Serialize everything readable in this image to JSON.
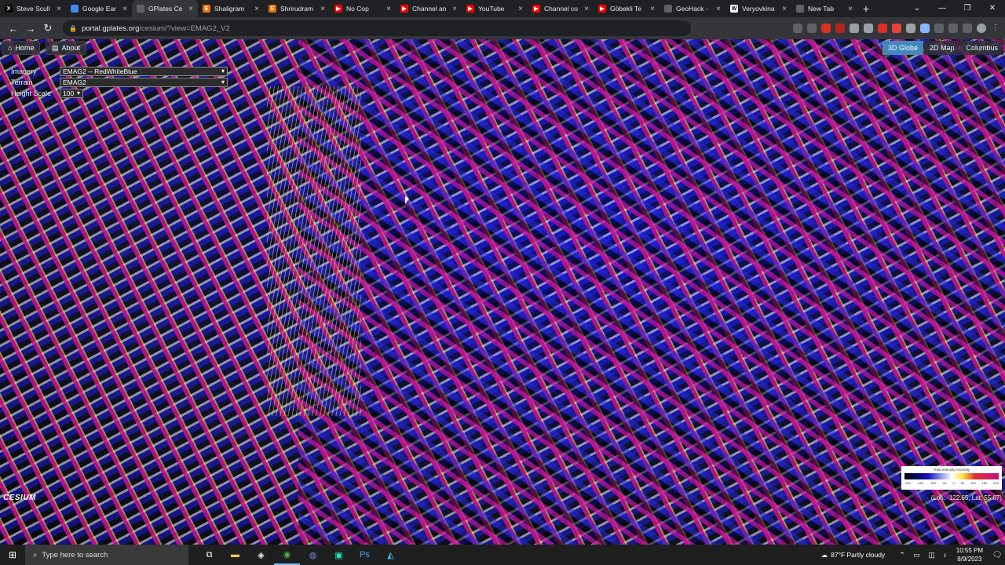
{
  "browser": {
    "tabs": [
      {
        "label": "Steve Scull",
        "icon": "x-icon",
        "color": "#000000",
        "glyph": "X"
      },
      {
        "label": "Google Ear",
        "icon": "google-earth-icon",
        "color": "#4285f4",
        "glyph": ""
      },
      {
        "label": "GPlates Ce",
        "icon": "gplates-icon",
        "color": "#5f6368",
        "glyph": "",
        "active": true
      },
      {
        "label": "Shaligram",
        "icon": "blogger-icon",
        "color": "#e8710a",
        "glyph": "E"
      },
      {
        "label": "Shrirudram",
        "icon": "blogger-icon",
        "color": "#e8710a",
        "glyph": "E"
      },
      {
        "label": "No Cop",
        "icon": "youtube-icon",
        "color": "#ff0000",
        "glyph": "▶"
      },
      {
        "label": "Channel an",
        "icon": "youtube-icon",
        "color": "#ff0000",
        "glyph": "▶"
      },
      {
        "label": "YouTube",
        "icon": "youtube-icon",
        "color": "#ff0000",
        "glyph": "▶"
      },
      {
        "label": "Channel co",
        "icon": "youtube-icon",
        "color": "#ff0000",
        "glyph": "▶"
      },
      {
        "label": "Göbekli Te",
        "icon": "youtube-icon",
        "color": "#ff0000",
        "glyph": "▶"
      },
      {
        "label": "GeoHack -",
        "icon": "globe-icon",
        "color": "#5f6368",
        "glyph": ""
      },
      {
        "label": "Veryovkina",
        "icon": "wikipedia-icon",
        "color": "#ffffff",
        "glyph": "W"
      },
      {
        "label": "New Tab",
        "icon": "chrome-icon",
        "color": "#5f6368",
        "glyph": ""
      }
    ],
    "url_host": "portal.gplates.org",
    "url_path": "/cesium/?view=EMAG2_V2"
  },
  "cesium": {
    "home_label": "Home",
    "about_label": "About",
    "modes": [
      "3D Globe",
      "2D Map",
      "Columbus"
    ],
    "active_mode": "3D Globe",
    "imagery_label": "Imagery",
    "imagery_value": "EMAG2 -- RedWhiteBlue",
    "terrain_label": "Terrain",
    "terrain_value": "EMAG2",
    "height_label": "Height Scale",
    "height_value": "100",
    "logo_text": "CESIUM",
    "legend_title": "Total Intensity Anomaly",
    "legend_ticks": [
      "-200",
      "-150",
      "-100",
      "-50",
      "0",
      "50",
      "100",
      "150",
      "200"
    ],
    "coords_text": "(Lon: -122.65, Lat: 55.67)"
  },
  "taskbar": {
    "search_placeholder": "Type here to search",
    "weather": "87°F  Partly cloudy",
    "time": "10:55 PM",
    "date": "8/9/2023"
  }
}
